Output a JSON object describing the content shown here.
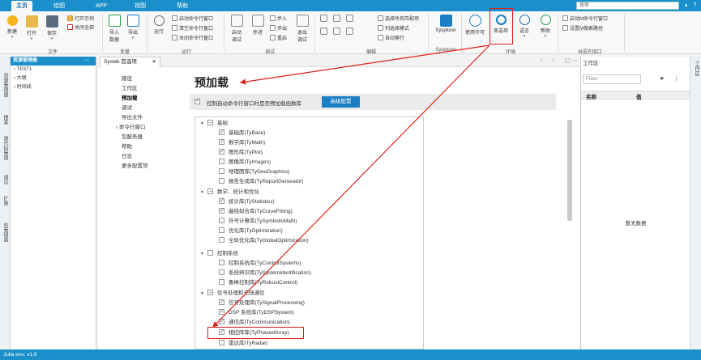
{
  "top_tabs": [
    "主页",
    "绘图",
    "APP",
    "视图",
    "帮助"
  ],
  "search": {
    "placeholder": "搜索"
  },
  "window_controls": [
    "▴",
    "?"
  ],
  "ribbon": {
    "new": "新建",
    "open": "打开",
    "save": "保存",
    "open_example": "打开示例",
    "close_all": "关闭全部",
    "import_data": "导入\n数据",
    "export_data": "导出",
    "run": "运行",
    "start_cmd_window": "启动命令行窗口",
    "clear_cmd_window": "清空命令行窗口",
    "close_cmd_window": "关闭命令行窗口",
    "start_debug": "启动\n调试",
    "step": "步进",
    "step_into": "步入",
    "step_out": "步出",
    "restart": "重启",
    "exit_debug": "退出\n调试",
    "select_all_matches": "选择所有匹配项",
    "column_select": "列选择模式",
    "auto_wrap": "自动换行",
    "sysplorer": "Sysplorer",
    "license": "使用许可",
    "preferences": "首选项",
    "language": "语言",
    "help": "帮助",
    "start_m_cmd": "启动M命令行窗口",
    "set_m_search_path": "设置M搜索路径",
    "groups": {
      "file": "文件",
      "variable": "变量",
      "run": "运行",
      "debug": "调试",
      "edit": "编辑",
      "sysplorer": "Sysplorer",
      "env": "环境",
      "m_lang": "M语言接口"
    }
  },
  "left_strip": [
    "资源管理器",
    "搜索",
    "源代码管理",
    "调试",
    "扩展",
    "包管理器"
  ],
  "resource_panel": {
    "title": "资源管理器",
    "more": "···",
    "items": [
      "› TEST1",
      "› 大纲",
      "› 时间线"
    ]
  },
  "doc_tab": {
    "label": "Syslab 首选项",
    "close": "✕"
  },
  "preferences": {
    "side_items": [
      "路径",
      "工作区",
      "预加载",
      "调试",
      "导出文件",
      "命令行窗口",
      "包服务器",
      "帮助",
      "日志",
      "更多配置项"
    ],
    "active_index": 2,
    "section_title": "预加载",
    "control_label": "控制启动命令行窗口时是否预加载函数库",
    "advanced_button": "高级配置",
    "groups": [
      {
        "label": "基础",
        "items": [
          "基础库(TyBase)",
          "数学库(TyMath)",
          "图形库(TyPlot)",
          "图像库(TyImages)",
          "地理图库(TyGeoGraphics)",
          "报告生成库(TyReportGenerator)"
        ],
        "checked": [
          true,
          true,
          true,
          false,
          false,
          false
        ]
      },
      {
        "label": "数学、统计和优化",
        "items": [
          "统计库(TyStatistics)",
          "曲线拟合库(TyCurveFitting)",
          "符号计算库(TySymbolicMath)",
          "优化库(TyOptimization)",
          "全局优化库(TyGlobalOptimization)"
        ],
        "checked": [
          true,
          true,
          false,
          false,
          false
        ]
      },
      {
        "label": "控制系统",
        "items": [
          "控制系统库(TyControlSystems)",
          "系统辨识库(TySystemIdentification)",
          "鲁棒控制库(TyRobustControl)"
        ],
        "checked": [
          false,
          false,
          false
        ]
      },
      {
        "label": "信号处理和无线通信",
        "items": [
          "信号处理库(TySignalProcessing)",
          "DSP 系统库(TyDSPSystem)",
          "通信库(TyCommunication)",
          "相控阵库(TyPhasedArray)",
          "雷达库(TyRadar)"
        ],
        "checked": [
          true,
          true,
          true,
          true,
          false
        ]
      }
    ]
  },
  "workspace": {
    "title": "工作区",
    "filter_placeholder": "Filter",
    "col_name": "名称",
    "col_value": "值",
    "empty": "暂无数据"
  },
  "right_strip": "工作区",
  "status": "Julia env: v1.9",
  "colors": {
    "accent": "#1a8fc9",
    "annotation": "#e0201a"
  }
}
